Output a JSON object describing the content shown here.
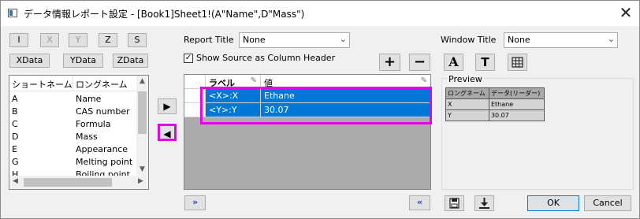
{
  "window": {
    "title": "データ情報レポート設定 - [Book1]Sheet1!(A\"Name\",D\"Mass\")",
    "close_glyph": "✕"
  },
  "axis_buttons": [
    "I",
    "X",
    "Y",
    "Z",
    "S"
  ],
  "data_buttons": [
    "XData",
    "YData",
    "ZData"
  ],
  "column_list": {
    "headers": [
      "ショートネーム",
      "ロングネーム"
    ],
    "rows": [
      {
        "short": "A",
        "long": "Name"
      },
      {
        "short": "B",
        "long": "CAS number"
      },
      {
        "short": "C",
        "long": "Formula"
      },
      {
        "short": "D",
        "long": "Mass"
      },
      {
        "short": "E",
        "long": "Appearance"
      },
      {
        "short": "G",
        "long": "Melting point"
      },
      {
        "short": "H",
        "long": "Boiling point"
      }
    ]
  },
  "report_title": {
    "label": "Report Title",
    "value": "None"
  },
  "show_source": {
    "label": "Show Source as Column Header",
    "checked": true
  },
  "grid": {
    "headers": [
      "ラベル",
      "値"
    ],
    "rows": [
      {
        "label": "<X>:X",
        "value": "Ethane"
      },
      {
        "label": "<Y>:Y",
        "value": "30.07"
      }
    ]
  },
  "window_title": {
    "label": "Window Title",
    "value": "None"
  },
  "preview": {
    "label": "Preview",
    "headers": [
      "ロングネーム",
      "データ(リーダー)"
    ],
    "rows": [
      [
        "X",
        "Ethane"
      ],
      [
        "Y",
        "30.07"
      ]
    ]
  },
  "buttons": {
    "ok": "OK",
    "cancel": "Cancel",
    "add": "+",
    "remove": "−",
    "font": "A",
    "text": "T",
    "move_right": "▶",
    "move_left": "◀",
    "expand": "»",
    "collapse": "«"
  }
}
